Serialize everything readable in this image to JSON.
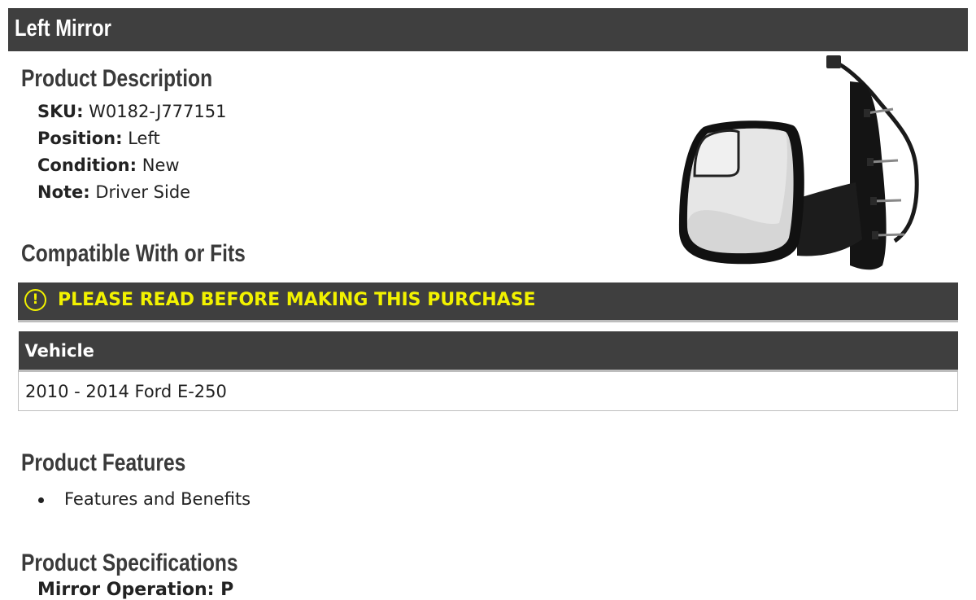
{
  "title": "Left Mirror",
  "description": {
    "heading": "Product Description",
    "rows": [
      {
        "label": "SKU:",
        "value": "W0182-J777151"
      },
      {
        "label": "Position:",
        "value": "Left"
      },
      {
        "label": "Condition:",
        "value": "New"
      },
      {
        "label": "Note:",
        "value": "Driver Side"
      }
    ]
  },
  "compatibility": {
    "heading": "Compatible With or Fits",
    "notice": "PLEASE READ BEFORE MAKING THIS PURCHASE",
    "notice_icon": "!",
    "table": {
      "header": "Vehicle",
      "rows": [
        "2010 - 2014 Ford E-250"
      ]
    }
  },
  "features": {
    "heading": "Product Features",
    "items": [
      "Features and Benefits"
    ]
  },
  "specifications": {
    "heading": "Product Specifications",
    "partial_line": "Mirror Operation: P"
  },
  "colors": {
    "bar": "#3f3f3f",
    "notice_text": "#f2f200"
  },
  "image": {
    "icon": "side-mirror-image"
  }
}
